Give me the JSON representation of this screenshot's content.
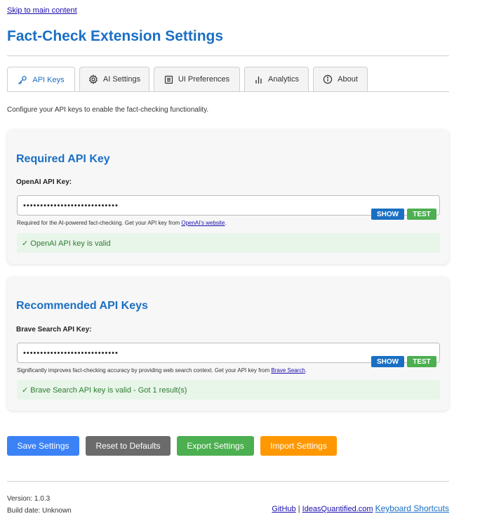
{
  "skip_link": "Skip to main content",
  "page_title": "Fact-Check Extension Settings",
  "tabs": [
    {
      "label": "API Keys",
      "icon": "key-icon",
      "active": true
    },
    {
      "label": "AI Settings",
      "icon": "gear-icon",
      "active": false
    },
    {
      "label": "UI Preferences",
      "icon": "layout-icon",
      "active": false
    },
    {
      "label": "Analytics",
      "icon": "bar-chart-icon",
      "active": false
    },
    {
      "label": "About",
      "icon": "info-icon",
      "active": false
    }
  ],
  "intro_text": "Configure your API keys to enable the fact-checking functionality.",
  "required": {
    "heading": "Required API Key",
    "field_label": "OpenAI API Key:",
    "value": "••••••••••••••••••••••••••••",
    "show_label": "SHOW",
    "test_label": "TEST",
    "help_prefix": "Required for the AI-powered fact-checking. Get your API key from ",
    "help_link": "OpenAI's website",
    "help_suffix": ".",
    "status": "✓ OpenAI API key is valid"
  },
  "recommended": {
    "heading": "Recommended API Keys",
    "field_label": "Brave Search API Key:",
    "value": "••••••••••••••••••••••••••••",
    "show_label": "SHOW",
    "test_label": "TEST",
    "help_prefix": "Significantly improves fact-checking accuracy by providing web search context. Get your API key from ",
    "help_link": "Brave Search",
    "help_suffix": ".",
    "status": "✓ Brave Search API key is valid - Got 1 result(s)"
  },
  "actions": {
    "save": "Save Settings",
    "reset": "Reset to Defaults",
    "export": "Export Settings",
    "import": "Import Settings"
  },
  "footer": {
    "version": "Version: 1.0.3",
    "build_date": "Build date: Unknown",
    "github": "GitHub",
    "separator": "|",
    "ideas": "IdeasQuantified.com",
    "shortcuts": "Keyboard Shortcuts"
  },
  "colors": {
    "accent": "#1a6fc4",
    "save": "#3b82f6",
    "reset": "#6b6b6b",
    "export": "#4caf50",
    "import": "#ff9800",
    "status_bg": "#e8f5e9",
    "status_text": "#2e7d32"
  }
}
